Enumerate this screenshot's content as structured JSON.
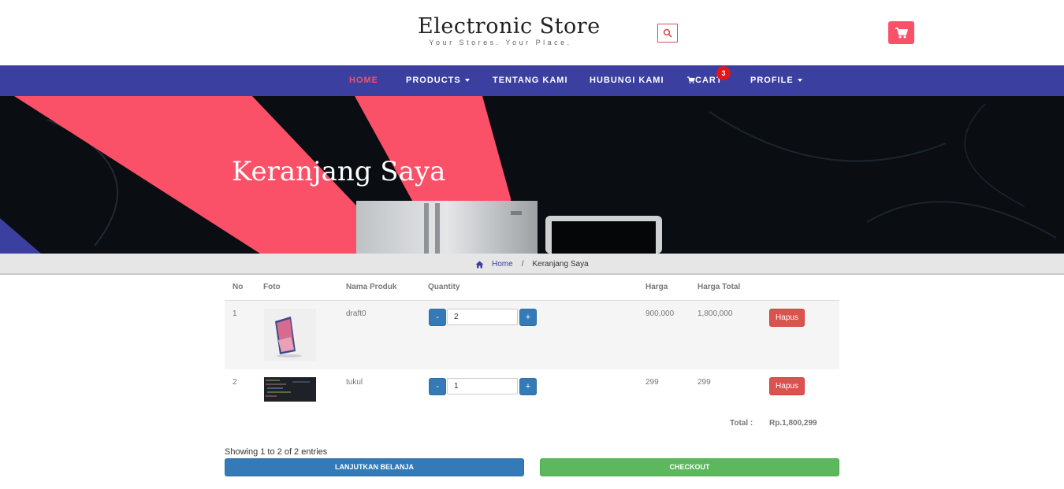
{
  "brand": {
    "title": "Electronic Store",
    "tagline": "Your Stores. Your Place.",
    "accent": "#fa5068",
    "nav_bg": "#3a3fa0"
  },
  "header": {
    "search_icon": "search-icon",
    "cart_icon": "cart-icon"
  },
  "nav": {
    "items": [
      {
        "label": "HOME",
        "active": true
      },
      {
        "label": "PRODUCTS",
        "dropdown": true
      },
      {
        "label": "TENTANG KAMI"
      },
      {
        "label": "HUBUNGI KAMI"
      },
      {
        "label": "CART"
      },
      {
        "label": "PROFILE",
        "dropdown": true
      }
    ],
    "cart_count": "3"
  },
  "hero": {
    "title": "Keranjang Saya"
  },
  "breadcrumb": {
    "home": "Home",
    "separator": "/",
    "current": "Keranjang Saya"
  },
  "table": {
    "headers": {
      "no": "No",
      "foto": "Foto",
      "nama": "Nama Produk",
      "qty": "Quantity",
      "harga": "Harga",
      "total": "Harga Total"
    },
    "rows": [
      {
        "no": "1",
        "nama": "draft0",
        "qty": "2",
        "harga": "900,000",
        "total": "1,800,000",
        "action": "Hapus",
        "minus": "-",
        "plus": "+"
      },
      {
        "no": "2",
        "nama": "tukul",
        "qty": "1",
        "harga": "299",
        "total": "299",
        "action": "Hapus",
        "minus": "-",
        "plus": "+"
      }
    ],
    "total_label": "Total :",
    "total_value": "Rp.1,800,299"
  },
  "footer": {
    "showing": "Showing 1 to 2 of 2 entries",
    "continue_label": "LANJUTKAN BELANJA",
    "checkout_label": "CHECKOUT"
  }
}
